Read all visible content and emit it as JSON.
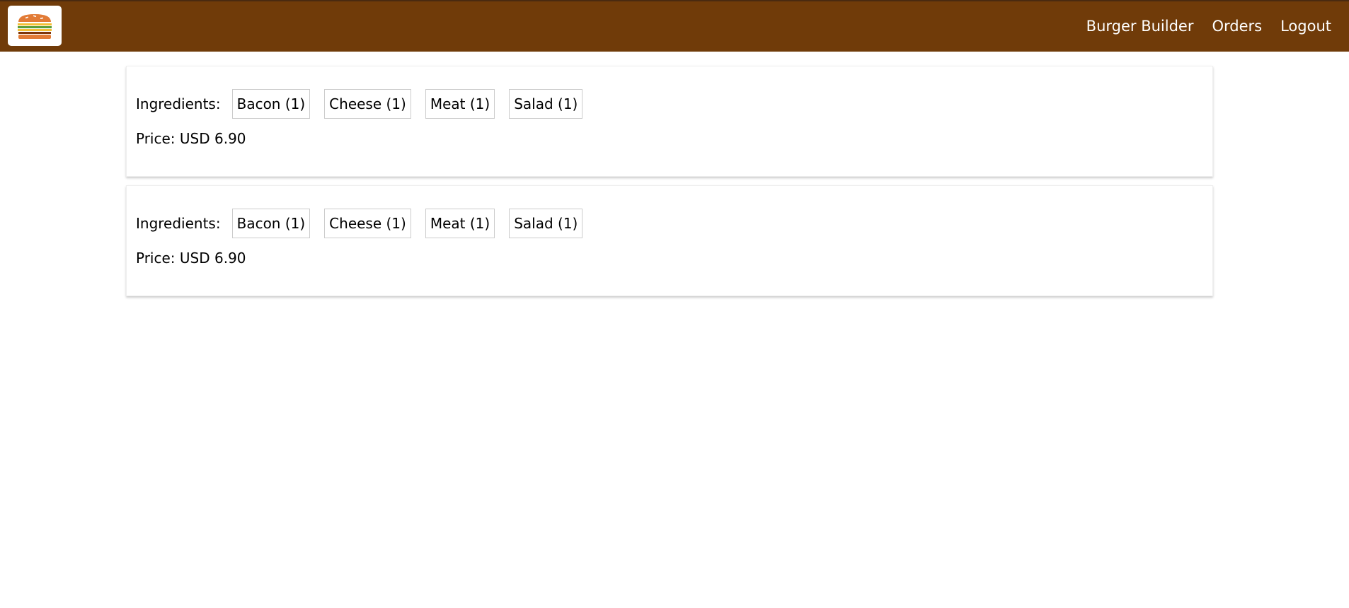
{
  "header": {
    "logo_icon": "burger-icon",
    "nav": [
      {
        "label": "Burger Builder"
      },
      {
        "label": "Orders"
      },
      {
        "label": "Logout"
      }
    ]
  },
  "orders": [
    {
      "ingredients_label": "Ingredients:",
      "ingredients": [
        "Bacon (1)",
        "Cheese (1)",
        "Meat (1)",
        "Salad (1)"
      ],
      "price_label": "Price:",
      "currency": "USD",
      "price": "6.90"
    },
    {
      "ingredients_label": "Ingredients:",
      "ingredients": [
        "Bacon (1)",
        "Cheese (1)",
        "Meat (1)",
        "Salad (1)"
      ],
      "price_label": "Price:",
      "currency": "USD",
      "price": "6.90"
    }
  ],
  "colors": {
    "toolbar": "#703B09",
    "bun": "#E27B36",
    "salad": "#5C9E3A",
    "cheese": "#F4C037",
    "meat": "#7F3608"
  }
}
